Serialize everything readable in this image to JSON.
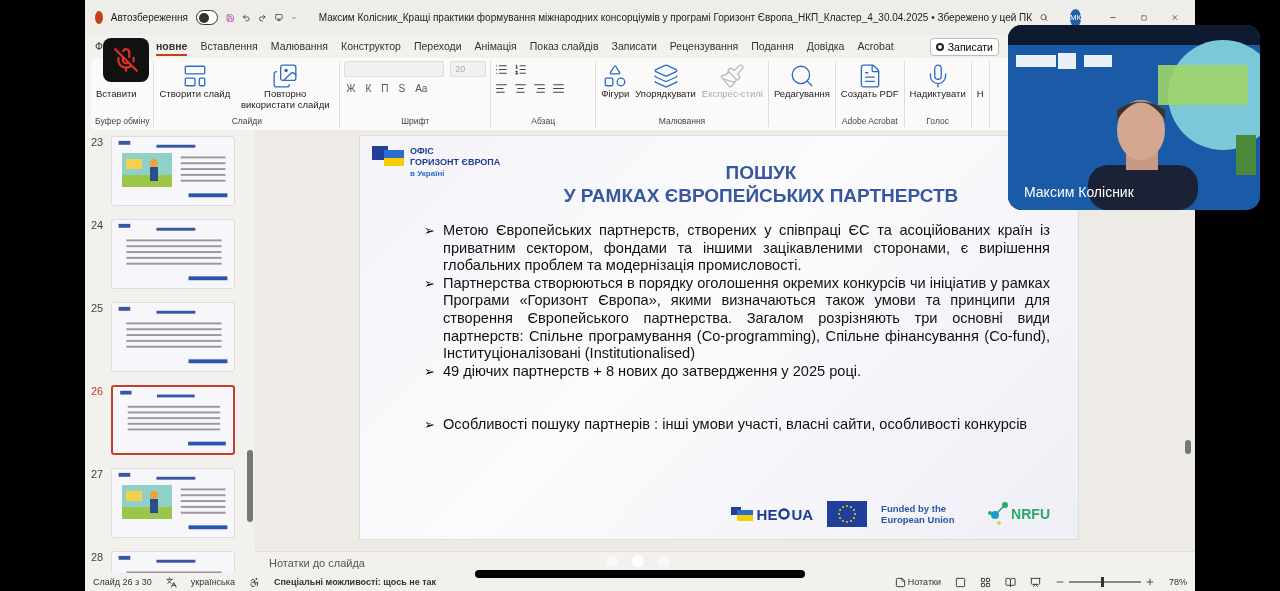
{
  "title_bar": {
    "autosave_label": "Автозбереження",
    "autosave_on": false,
    "document_title": "Максим Колісник_Кращі практики формування міжнародних консорціумів у програмі Горизонт Європа_НКП_Кластер_4_30.04.2025 • Збережено у цей ПК",
    "avatar": "МК"
  },
  "tabs": [
    {
      "label": "Ф",
      "selected": false
    },
    {
      "label": "новне",
      "selected": true
    },
    {
      "label": "Вставлення",
      "selected": false
    },
    {
      "label": "Малювання",
      "selected": false
    },
    {
      "label": "Конструктор",
      "selected": false
    },
    {
      "label": "Переходи",
      "selected": false
    },
    {
      "label": "Анімація",
      "selected": false
    },
    {
      "label": "Показ слайдів",
      "selected": false
    },
    {
      "label": "Записати",
      "selected": false
    },
    {
      "label": "Рецензування",
      "selected": false
    },
    {
      "label": "Подання",
      "selected": false
    },
    {
      "label": "Довідка",
      "selected": false
    },
    {
      "label": "Acrobat",
      "selected": false
    }
  ],
  "record_button": "Записати",
  "ribbon": [
    {
      "kind": "large",
      "label": "Буфер обміну",
      "buttons": [
        {
          "label": "Вставити",
          "disabled": false
        }
      ]
    },
    {
      "kind": "large",
      "label": "Слайди",
      "buttons": [
        {
          "label": "Створити слайд",
          "disabled": false
        },
        {
          "label": "Повторно використати слайди",
          "disabled": false
        }
      ]
    },
    {
      "kind": "font",
      "label": "Шрифт",
      "size": "20",
      "format_buttons": [
        "Ж",
        "К",
        "П",
        "S"
      ],
      "case_button": "Aa"
    },
    {
      "kind": "paragraph",
      "label": "Абзац"
    },
    {
      "kind": "large",
      "label": "Малювання",
      "buttons": [
        {
          "label": "Фігури",
          "disabled": false
        },
        {
          "label": "Упорядкувати",
          "disabled": false
        },
        {
          "label": "Експрес-стилі",
          "disabled": true
        }
      ]
    },
    {
      "kind": "large",
      "buttons": [
        {
          "label": "Редагування",
          "disabled": false
        }
      ]
    },
    {
      "kind": "large",
      "label": "Adobe Acrobat",
      "buttons": [
        {
          "label": "Создать PDF",
          "disabled": false
        }
      ]
    },
    {
      "kind": "large",
      "label": "Голос",
      "buttons": [
        {
          "label": "Надиктувати",
          "disabled": false
        }
      ]
    },
    {
      "kind": "large",
      "buttons": [
        {
          "label": "Н"
        }
      ]
    }
  ],
  "thumbnails": [
    {
      "number": "23",
      "kind": "picture",
      "selected": false
    },
    {
      "number": "24",
      "kind": "text",
      "selected": false
    },
    {
      "number": "25",
      "kind": "text",
      "selected": false
    },
    {
      "number": "26",
      "kind": "text",
      "selected": true
    },
    {
      "number": "27",
      "kind": "picture",
      "selected": false
    },
    {
      "number": "28",
      "kind": "text",
      "selected": false
    }
  ],
  "slide": {
    "office_logo": [
      "ОФІС",
      "ГОРИЗОНТ ЄВРОПА",
      "в Україні"
    ],
    "title": [
      "ПОШУК",
      "У РАМКАХ ЄВРОПЕЙСЬКИХ ПАРТНЕРСТВ"
    ],
    "marker": "➢",
    "bullets": [
      "Метою Європейських партнерств, створених у співпраці ЄС та асоційованих країн із приватним сектором, фондами та іншими зацікавленими сторонами, є вирішення глобальних проблем та модернізація промисловості.",
      "Партнерства створюються в порядку оголошення окремих конкурсів чи ініціатив у рамках Програми «Горизонт Європа», якими визначаються також умови та принципи для створення Європейського партнерства. Загалом розрізняють три основні види партнерств: Спільне програмування (Co-programming), Спільне фінансування (Co-fund), Інституціоналізовані (Institutionalised)",
      "49 діючих партнерств + 8 нових до затвердження  у 2025 році.",
      "Особливості пошуку партнерів : інші умови участі, власні сайти, особливості конкурсів"
    ],
    "footer": {
      "hec_left": "HE",
      "hec_right": "UA",
      "eu_funded": "Funded by the European Union",
      "nrfu": "NRFU"
    }
  },
  "notes_placeholder": "Нотатки до слайда",
  "status_bar": {
    "slide": "Слайд 26 з 30",
    "language": "українська",
    "accessibility": "Спеціальні можливості: щось не так",
    "notes": "Нотатки",
    "zoom": "78%",
    "zoom_slider": {
      "level": 0.45
    }
  },
  "video": {
    "name": "Максим Колісник",
    "muted": true
  }
}
